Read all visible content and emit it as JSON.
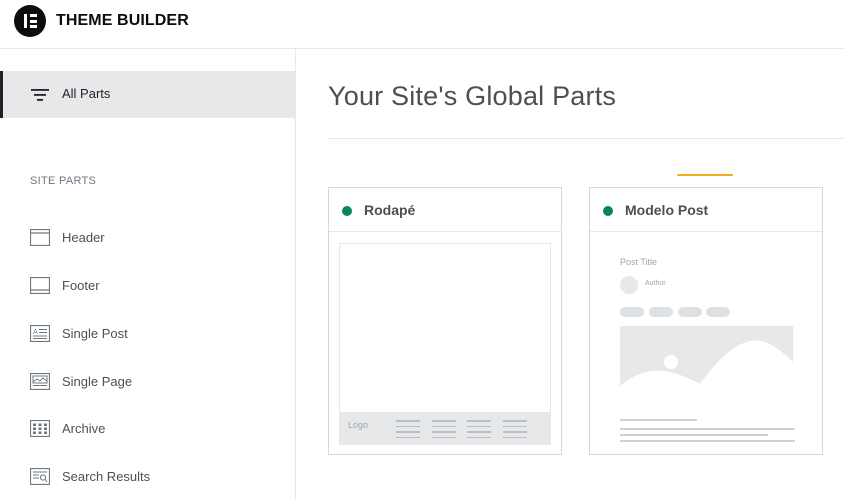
{
  "app": {
    "title": "THEME BUILDER"
  },
  "sidebar": {
    "all_parts_label": "All Parts",
    "section_title": "SITE PARTS",
    "items": [
      {
        "label": "Header",
        "icon": "header-icon"
      },
      {
        "label": "Footer",
        "icon": "footer-icon"
      },
      {
        "label": "Single Post",
        "icon": "single-post-icon"
      },
      {
        "label": "Single Page",
        "icon": "single-page-icon"
      },
      {
        "label": "Archive",
        "icon": "archive-icon"
      },
      {
        "label": "Search Results",
        "icon": "search-results-icon"
      }
    ]
  },
  "main": {
    "title": "Your Site's Global Parts",
    "cards": [
      {
        "title": "Rodapé",
        "status": "active",
        "preview": {
          "logo_text": "Logo"
        }
      },
      {
        "title": "Modelo Post",
        "status": "active",
        "preview": {
          "post_title": "Post Title",
          "author": "Author"
        }
      }
    ]
  },
  "colors": {
    "status_active": "#0a875a",
    "accent": "#f0ad22",
    "selected_bg": "#e6e8ea",
    "text_dark": "#1f2124",
    "text_muted": "#495157"
  }
}
